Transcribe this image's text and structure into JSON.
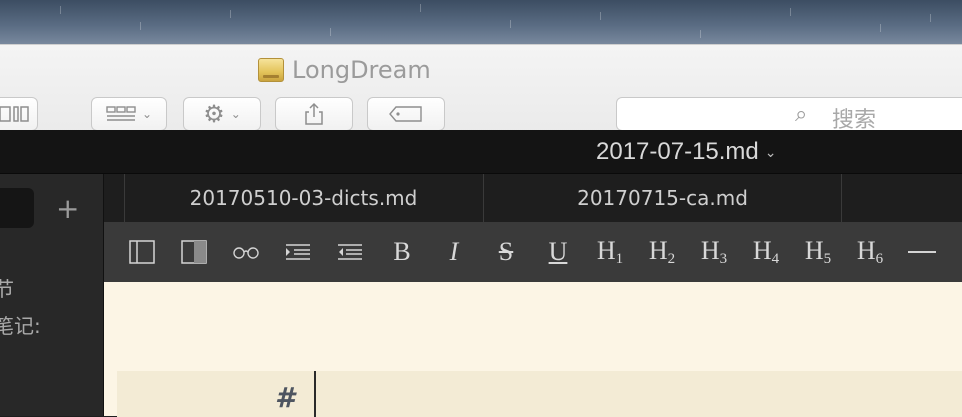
{
  "finder": {
    "title": "LongDream",
    "search_placeholder": "搜索"
  },
  "app": {
    "document_title": "2017-07-15.md",
    "sidebar": {
      "add_label": "+",
      "lines": [
        "节",
        "笔记:"
      ]
    },
    "tabs": [
      {
        "label": "20170510-03-dicts.md"
      },
      {
        "label": "20170715-ca.md"
      }
    ],
    "toolbar": {
      "headings": [
        "H1",
        "H2",
        "H3",
        "H4",
        "H5",
        "H6"
      ],
      "bold": "B",
      "italic": "I",
      "strike": "S",
      "underline": "U"
    },
    "editor": {
      "heading_marker": "#"
    }
  }
}
